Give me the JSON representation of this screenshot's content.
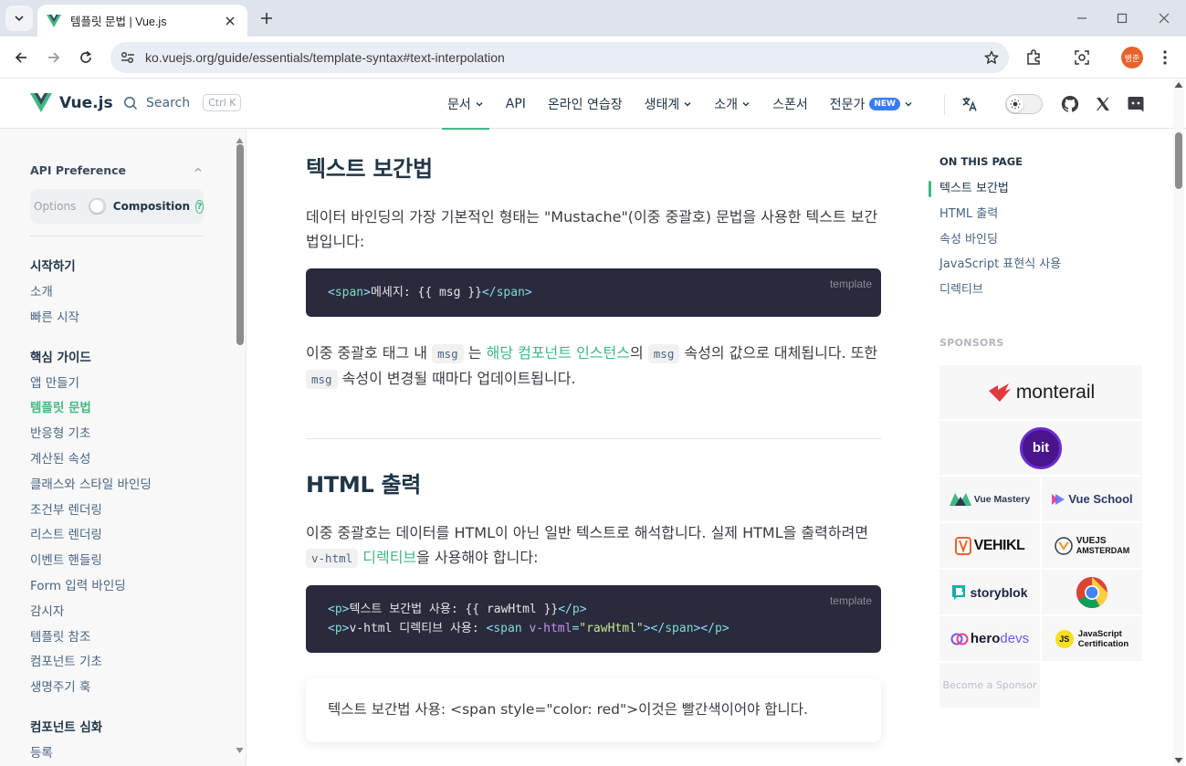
{
  "browser": {
    "tab_title": "템플릿 문법 | Vue.js",
    "url": "ko.vuejs.org/guide/essentials/template-syntax#text-interpolation",
    "profile_initials": "병준"
  },
  "nav": {
    "logo": "Vue.js",
    "search_label": "Search",
    "search_shortcut": "Ctrl K",
    "menu": [
      {
        "label": "문서",
        "dropdown": true,
        "active": true
      },
      {
        "label": "API",
        "dropdown": false
      },
      {
        "label": "온라인 연습장",
        "dropdown": false
      },
      {
        "label": "생태계",
        "dropdown": true
      },
      {
        "label": "소개",
        "dropdown": true
      },
      {
        "label": "스폰서",
        "dropdown": false
      },
      {
        "label": "전문가",
        "dropdown": true,
        "badge": "NEW"
      }
    ]
  },
  "sidebar": {
    "api_preference": "API Preference",
    "options_label": "Options",
    "composition_label": "Composition",
    "help_glyph": "?",
    "groups": [
      {
        "title": "시작하기",
        "items": [
          "소개",
          "빠른 시작"
        ]
      },
      {
        "title": "핵심 가이드",
        "items": [
          "앱 만들기",
          "템플릿 문법",
          "반응형 기초",
          "계산된 속성",
          "클래스와 스타일 바인딩",
          "조건부 렌더링",
          "리스트 렌더링",
          "이벤트 핸들링",
          "Form 입력 바인딩",
          "감시자",
          "템플릿 참조",
          "컴포넌트 기초",
          "생명주기 훅"
        ]
      },
      {
        "title": "컴포넌트 심화",
        "items": [
          "등록"
        ]
      }
    ],
    "active_item": "템플릿 문법"
  },
  "main": {
    "section1": {
      "heading": "텍스트 보간법",
      "intro": "데이터 바인딩의 가장 기본적인 형태는 \"Mustache\"(이중 중괄호) 문법을 사용한 텍스트 보간법입니다:",
      "code_lang": "template",
      "code_open_tag": "span",
      "code_text": "메세지: {{ msg }}",
      "code_close_tag": "span",
      "p2_part1": "이중 중괄호 태그 내 ",
      "p2_code1": "msg",
      "p2_part2": " 는 ",
      "p2_link": "해당 컴포넌트 인스턴스",
      "p2_part3": "의 ",
      "p2_code2": "msg",
      "p2_part4": " 속성의 값으로 대체됩니다. 또한 ",
      "p2_code3": "msg",
      "p2_part5": " 속성이 변경될 때마다 업데이트됩니다."
    },
    "section2": {
      "heading": "HTML 출력",
      "p_part1": "이중 중괄호는 데이터를 HTML이 아닌 일반 텍스트로 해석합니다. 실제 HTML을 출력하려면 ",
      "p_code": "v-html",
      "p_link": "디렉티브",
      "p_part2": "을 사용해야 합니다:",
      "code_lang": "template",
      "code_line1_text": "텍스트 보간법 사용: {{ rawHtml }}",
      "code_line2_text": "v-html 디렉티브 사용: ",
      "code_attr": "v-html",
      "code_attr_value": "\"rawHtml\"",
      "demo_text": "텍스트 보간법 사용: <span style=\"color: red\">이것은 빨간색이어야 합니다."
    }
  },
  "aside": {
    "toc_title": "ON THIS PAGE",
    "toc": [
      "텍스트 보간법",
      "HTML 출력",
      "속성 바인딩",
      "JavaScript 표현식 사용",
      "디렉티브"
    ],
    "sponsors_title": "SPONSORS",
    "sponsors": {
      "monterail": "monterail",
      "bit": "bit",
      "vue_mastery": "Vue Mastery",
      "vue_school": "Vue School",
      "vehikl": "VEHIKL",
      "vuejs_amsterdam_1": "VUEJS",
      "vuejs_amsterdam_2": "AMSTERDAM",
      "storyblok": "storyblok",
      "herodevs_1": "hero",
      "herodevs_2": "devs",
      "js_cert_badge": "JS",
      "js_cert_1": "JavaScript",
      "js_cert_2": "Certification",
      "become": "Become a Sponsor"
    }
  },
  "colors": {
    "accent": "#42b883",
    "code_bg": "#292b3c",
    "new_badge": "#3a7cf5",
    "profile": "#e8632c"
  }
}
